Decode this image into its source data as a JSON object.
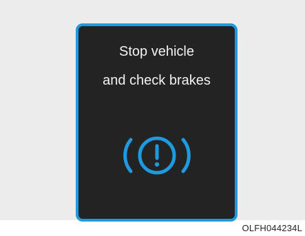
{
  "display": {
    "message_line1": "Stop vehicle",
    "message_line2": "and check brakes",
    "icon": "brake-warning-icon"
  },
  "caption": {
    "code": "OLFH044234L"
  },
  "colors": {
    "screen_background": "#232323",
    "accent": "#1e9be0",
    "text": "#f2f2f2",
    "page_background": "#ececec"
  }
}
